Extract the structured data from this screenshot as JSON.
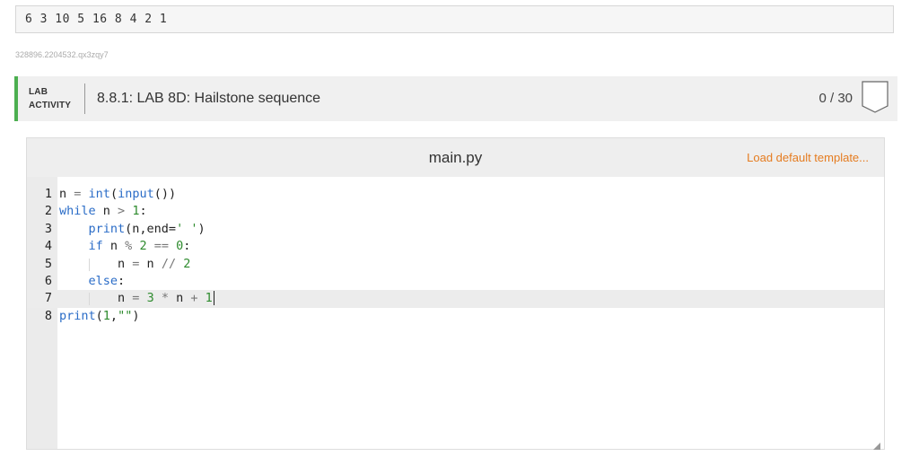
{
  "output": {
    "text": "6 3 10 5 16 8 4 2 1"
  },
  "ident": "328896.2204532.qx3zqy7",
  "lab": {
    "tag_line1": "LAB",
    "tag_line2": "ACTIVITY",
    "title": "8.8.1: LAB 8D: Hailstone sequence",
    "score": "0 / 30"
  },
  "editor": {
    "file_name": "main.py",
    "load_template": "Load default template..."
  },
  "code_lines": [
    "n = int(input())",
    "while n > 1:",
    "    print(n,end=' ')",
    "    if n % 2 == 0:",
    "        n = n // 2",
    "    else:",
    "        n = 3 * n + 1",
    "print(1,\"\")"
  ],
  "line_numbers": [
    "1",
    "2",
    "3",
    "4",
    "5",
    "6",
    "7",
    "8"
  ]
}
